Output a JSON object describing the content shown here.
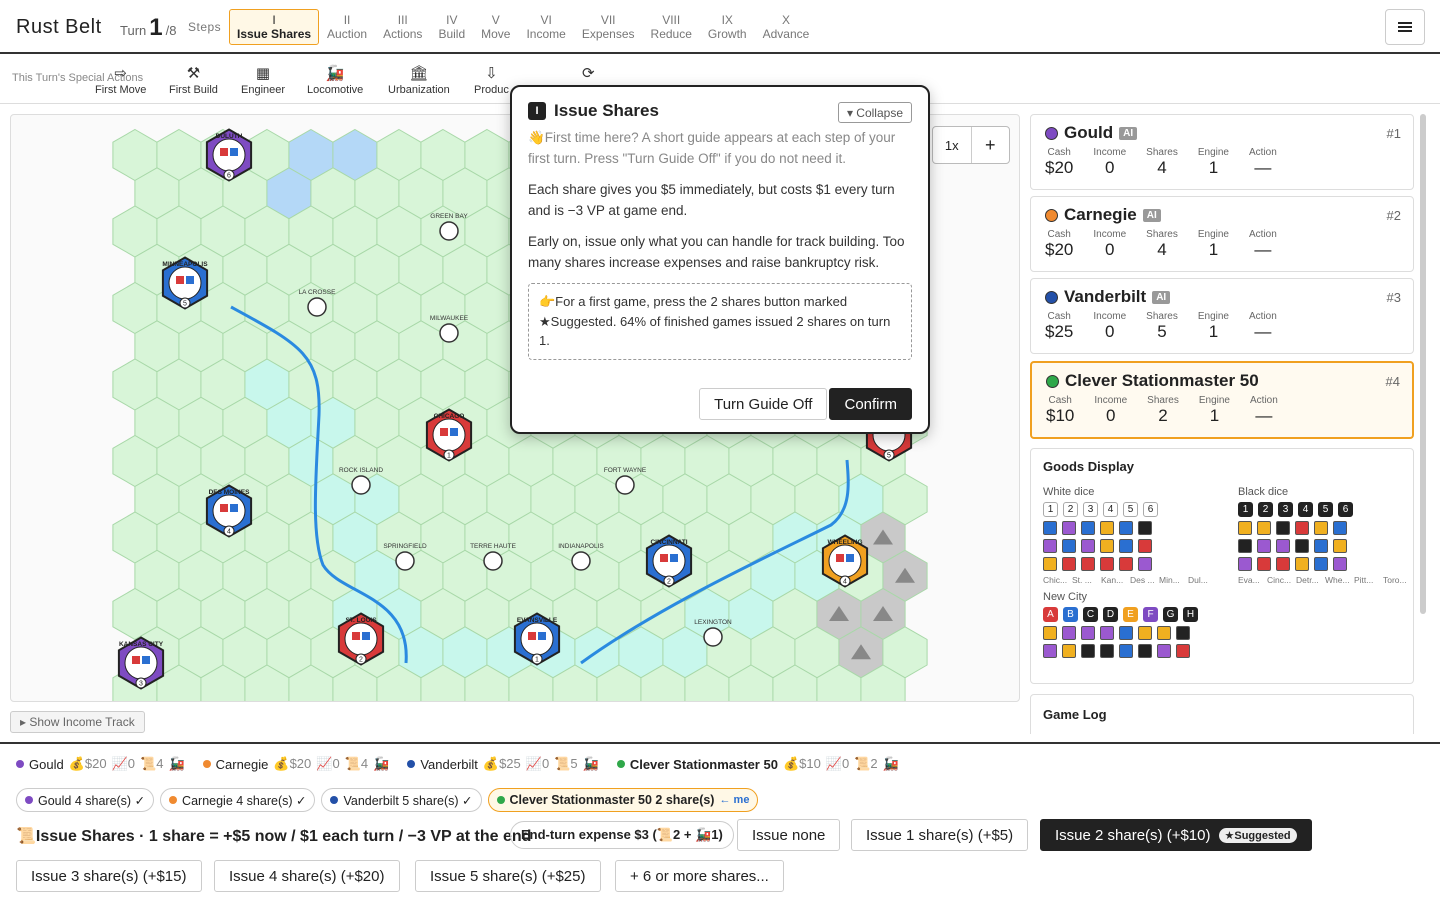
{
  "app": {
    "title": "Rust Belt",
    "turn_label": "Turn",
    "turn_current": "1",
    "turn_total": "/8",
    "steps_label": "Steps"
  },
  "steps": [
    {
      "roman": "I",
      "name": "Issue Shares",
      "active": true
    },
    {
      "roman": "II",
      "name": "Auction"
    },
    {
      "roman": "III",
      "name": "Actions"
    },
    {
      "roman": "IV",
      "name": "Build"
    },
    {
      "roman": "V",
      "name": "Move"
    },
    {
      "roman": "VI",
      "name": "Income"
    },
    {
      "roman": "VII",
      "name": "Expenses"
    },
    {
      "roman": "VIII",
      "name": "Reduce"
    },
    {
      "roman": "IX",
      "name": "Growth"
    },
    {
      "roman": "X",
      "name": "Advance"
    }
  ],
  "menu_icon": "hamburger-icon",
  "special": {
    "label": "This Turn's Special Actions",
    "items": [
      {
        "name": "First Move",
        "icon": "arrow-right-icon"
      },
      {
        "name": "First Build",
        "icon": "hammer-icon"
      },
      {
        "name": "Engineer",
        "icon": "grid-icon"
      },
      {
        "name": "Locomotive",
        "icon": "locomotive-icon"
      },
      {
        "name": "Urbanization",
        "icon": "building-icon"
      },
      {
        "name": "Produc",
        "icon": "production-icon"
      },
      {
        "name": "",
        "icon": "refresh-icon"
      }
    ]
  },
  "map": {
    "zoom_label": "1x",
    "zoom_in": "+",
    "income_track_btn": "▸ Show Income Track",
    "cities": [
      {
        "name": "DULUTH",
        "color": "#7e4bc2",
        "num": "6"
      },
      {
        "name": "MINNEAPOLIS",
        "color": "#2a6fd1",
        "num": "5"
      },
      {
        "name": "CHICAGO",
        "color": "#d83a3a",
        "num": "1"
      },
      {
        "name": "DES MOINES",
        "color": "#2a6fd1",
        "num": "4"
      },
      {
        "name": "ST. LOUIS",
        "color": "#d83a3a",
        "num": "2"
      },
      {
        "name": "EVANSVILLE",
        "color": "#2a6fd1",
        "num": "1"
      },
      {
        "name": "CINCINNATI",
        "color": "#2a6fd1",
        "num": "2"
      },
      {
        "name": "WHEELING",
        "color": "#f0a020",
        "num": "4"
      },
      {
        "name": "KANSAS CITY",
        "color": "#7e4bc2",
        "num": "3"
      }
    ],
    "towns": [
      "GREEN BAY",
      "LA CROSSE",
      "MILWAUKEE",
      "ROCK ISLAND",
      "FORT WAYNE",
      "SPRINGFIELD",
      "TERRE HAUTE",
      "INDIANAPOLIS",
      "LEXINGTON"
    ],
    "partial_city_num": "5"
  },
  "guide": {
    "badge": "I",
    "title": "Issue Shares",
    "collapse": "▾ Collapse",
    "intro": "👋First time here? A short guide appears at each step of your first turn. Press \"Turn Guide Off\" if you do not need it.",
    "p1": "Each share gives you $5 immediately, but costs $1 every turn and is −3 VP at game end.",
    "p2": "Early on, issue only what you can handle for track building. Too many shares increase expenses and raise bankruptcy risk.",
    "tip": "👉For a first game, press the 2 shares button marked ★Suggested. 64% of finished games issued 2 shares on turn 1.",
    "btn_off": "Turn Guide Off",
    "btn_confirm": "Confirm"
  },
  "stat_labels": {
    "cash": "Cash",
    "income": "Income",
    "shares": "Shares",
    "engine": "Engine",
    "action": "Action"
  },
  "players": [
    {
      "name": "Gould",
      "color": "#7e4bc2",
      "ai": "AI",
      "rank": "#1",
      "cash": "$20",
      "income": "0",
      "shares": "4",
      "engine": "1",
      "action": "—"
    },
    {
      "name": "Carnegie",
      "color": "#f08a30",
      "ai": "AI",
      "rank": "#2",
      "cash": "$20",
      "income": "0",
      "shares": "4",
      "engine": "1",
      "action": "—"
    },
    {
      "name": "Vanderbilt",
      "color": "#2350a8",
      "ai": "AI",
      "rank": "#3",
      "cash": "$25",
      "income": "0",
      "shares": "5",
      "engine": "1",
      "action": "—"
    },
    {
      "name": "Clever Stationmaster 50",
      "color": "#2fa84a",
      "ai": "",
      "rank": "#4",
      "cash": "$10",
      "income": "0",
      "shares": "2",
      "engine": "1",
      "action": "—",
      "me": true
    }
  ],
  "goods": {
    "title": "Goods Display",
    "white_label": "White dice",
    "black_label": "Black dice",
    "newcity_label": "New City",
    "white_nums": [
      "1",
      "2",
      "3",
      "4",
      "5",
      "6"
    ],
    "black_nums": [
      "1",
      "2",
      "3",
      "4",
      "5",
      "6"
    ],
    "white_cubes": [
      [
        "#2a6fd1",
        "#9b59d0",
        "#2a6fd1",
        "#f0b020",
        "#2a6fd1",
        "#222"
      ],
      [
        "#9b59d0",
        "#2a6fd1",
        "#9b59d0",
        "#f0b020",
        "#2a6fd1",
        "#d83a3a"
      ],
      [
        "#f0b020",
        "#d83a3a",
        "#d83a3a",
        "#d83a3a",
        "#d83a3a",
        "#9b59d0"
      ]
    ],
    "white_cities": [
      "Chic...",
      "St. ...",
      "Kan...",
      "Des ...",
      "Min...",
      "Dul..."
    ],
    "black_cubes": [
      [
        "#f0b020",
        "#f0b020",
        "#222",
        "#d83a3a",
        "#f0b020",
        "#2a6fd1"
      ],
      [
        "#222",
        "#9b59d0",
        "#9b59d0",
        "#222",
        "#2a6fd1",
        "#f0b020"
      ],
      [
        "#9b59d0",
        "#d83a3a",
        "#d83a3a",
        "#f0b020",
        "#2a6fd1",
        "#9b59d0"
      ]
    ],
    "black_cities": [
      "Eva...",
      "Cinc...",
      "Detr...",
      "Whe...",
      "Pitt...",
      "Toro..."
    ],
    "newcity_letters": [
      {
        "l": "A",
        "c": "#d83a3a"
      },
      {
        "l": "B",
        "c": "#2a6fd1"
      },
      {
        "l": "C",
        "c": "#222"
      },
      {
        "l": "D",
        "c": "#222"
      },
      {
        "l": "E",
        "c": "#f0a020"
      },
      {
        "l": "F",
        "c": "#7e4bc2"
      },
      {
        "l": "G",
        "c": "#222"
      },
      {
        "l": "H",
        "c": "#222"
      }
    ],
    "newcity_cubes": [
      [
        "#f0b020",
        "#9b59d0",
        "#9b59d0",
        "#9b59d0",
        "#2a6fd1",
        "#f0b020",
        "#f0b020",
        "#222"
      ],
      [
        "#9b59d0",
        "#f0b020",
        "#222",
        "#222",
        "#2a6fd1",
        "#222",
        "#9b59d0",
        "#d83a3a"
      ]
    ]
  },
  "log": {
    "title": "Game Log"
  },
  "summary": [
    {
      "name": "Gould",
      "color": "#7e4bc2",
      "cash": "💰$20",
      "income": "📈0",
      "shares": "📜4",
      "eng": "🚂"
    },
    {
      "name": "Carnegie",
      "color": "#f08a30",
      "cash": "💰$20",
      "income": "📈0",
      "shares": "📜4",
      "eng": "🚂"
    },
    {
      "name": "Vanderbilt",
      "color": "#2350a8",
      "cash": "💰$25",
      "income": "📈0",
      "shares": "📜5",
      "eng": "🚂"
    },
    {
      "name": "Clever Stationmaster 50",
      "color": "#2fa84a",
      "cash": "💰$10",
      "income": "📈0",
      "shares": "📜2",
      "eng": "🚂",
      "me": true
    }
  ],
  "chips": [
    {
      "label": "Gould 4 share(s) ✓",
      "color": "#7e4bc2"
    },
    {
      "label": "Carnegie 4 share(s) ✓",
      "color": "#f08a30"
    },
    {
      "label": "Vanderbilt 5 share(s) ✓",
      "color": "#2350a8"
    },
    {
      "label": "Clever Stationmaster 50 2 share(s)",
      "color": "#2fa84a",
      "me": "← me"
    }
  ],
  "issue": {
    "title": "📜Issue Shares · 1 share = +$5 now / $1 each turn / −3 VP at the end",
    "expense": "End-turn expense $3 (📜2 + 🚂1)",
    "options": [
      "Issue none",
      "Issue 1 share(s) (+$5)",
      "Issue 2 share(s) (+$10)",
      "Issue 3 share(s) (+$15)",
      "Issue 4 share(s) (+$20)",
      "Issue 5 share(s) (+$25)",
      "+ 6 or more shares..."
    ],
    "suggested": "★Suggested"
  }
}
